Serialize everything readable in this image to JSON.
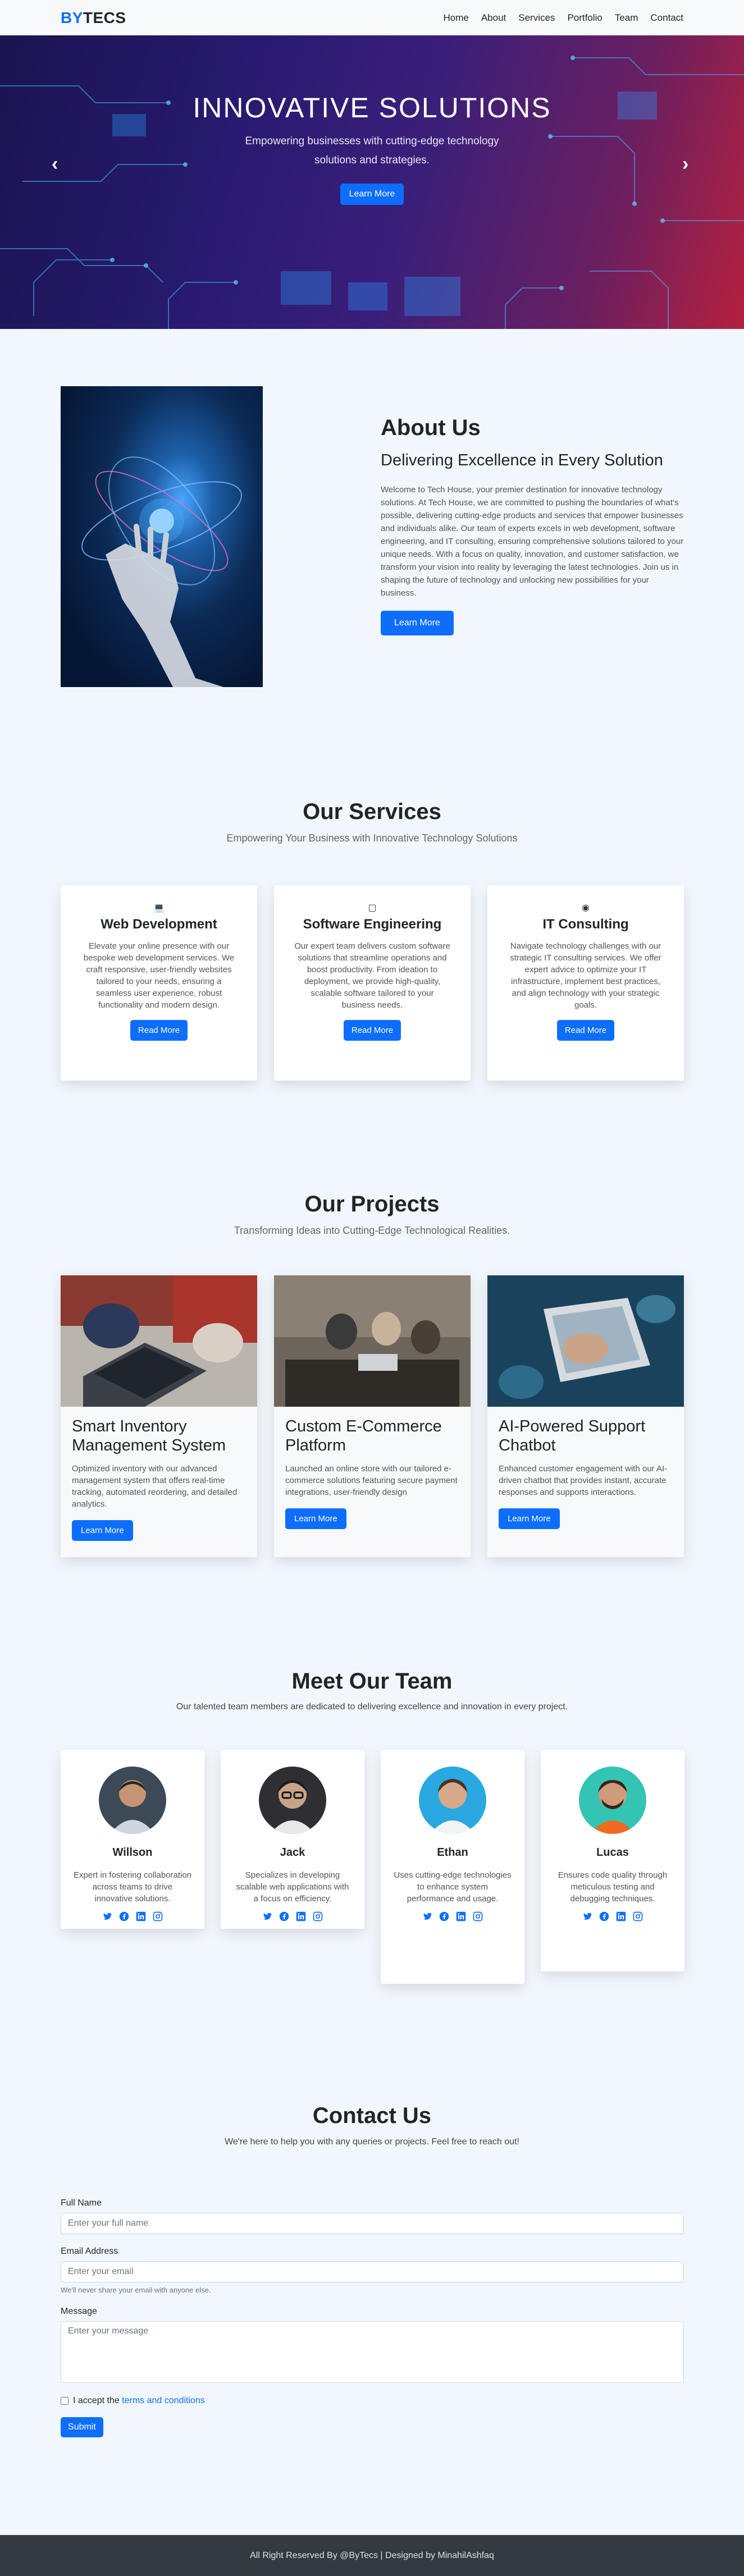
{
  "nav": {
    "brand_part1": "BY",
    "brand_part2": "TECS",
    "links": [
      "Home",
      "About",
      "Services",
      "Portfolio",
      "Team",
      "Contact"
    ]
  },
  "hero": {
    "title": "INNOVATIVE SOLUTIONS",
    "subtitle": "Empowering businesses with cutting-edge technology solutions and strategies.",
    "button": "Learn More",
    "prev_icon": "chevron-left-icon",
    "next_icon": "chevron-right-icon"
  },
  "about": {
    "title": "About Us",
    "subtitle": "Delivering Excellence in Every Solution",
    "body": "Welcome to Tech House, your premier destination for innovative technology solutions. At Tech House, we are committed to pushing the boundaries of what's possible, delivering cutting-edge products and services that empower businesses and individuals alike. Our team of experts excels in web development, software engineering, and IT consulting, ensuring comprehensive solutions tailored to your unique needs. With a focus on quality, innovation, and customer satisfaction, we transform your vision into reality by leveraging the latest technologies. Join us in shaping the future of technology and unlocking new possibilities for your business.",
    "button": "Learn More"
  },
  "services": {
    "title": "Our Services",
    "subtitle": "Empowering Your Business with Innovative Technology Solutions",
    "items": [
      {
        "icon": "laptop-icon",
        "glyph": "💻",
        "title": "Web Development",
        "text": "Elevate your online presence with our bespoke web development services. We craft responsive, user-friendly websites tailored to your needs, ensuring a seamless user experience, robust functionality and modern design.",
        "button": "Read More"
      },
      {
        "icon": "code-window-icon",
        "glyph": "▢",
        "title": "Software Engineering",
        "text": "Our expert team delivers custom software solutions that streamline operations and boost productivity. From ideation to deployment, we provide high-quality, scalable software tailored to your business needs.",
        "button": "Read More"
      },
      {
        "icon": "radio-target-icon",
        "glyph": "◉",
        "title": "IT Consulting",
        "text": "Navigate technology challenges with our strategic IT consulting services. We offer expert advice to optimize your IT infrastructure, implement best practices, and align technology with your strategic goals.",
        "button": "Read More"
      }
    ]
  },
  "projects": {
    "title": "Our Projects",
    "subtitle": "Transforming Ideas into Cutting-Edge Technological Realities.",
    "items": [
      {
        "title": "Smart Inventory Management System",
        "text": "Optimized inventory with our advanced management system that offers real-time tracking, automated reordering, and detailed analytics.",
        "button": "Learn More"
      },
      {
        "title": "Custom E-Commerce Platform",
        "text": "Launched an online store with our tailored e-commerce solutions featuring secure payment integrations, user-friendly design",
        "button": "Learn More"
      },
      {
        "title": "AI-Powered Support Chatbot",
        "text": "Enhanced customer engagement with our AI-driven chatbot that provides instant, accurate responses and supports interactions.",
        "button": "Learn More"
      }
    ]
  },
  "team": {
    "title": "Meet Our Team",
    "subtitle": "Our talented team members are dedicated to delivering excellence and innovation in every project.",
    "social_icons": [
      "twitter-icon",
      "facebook-icon",
      "linkedin-icon",
      "instagram-icon"
    ],
    "members": [
      {
        "name": "Willson",
        "text": "Expert in fostering collaboration across teams to drive innovative solutions."
      },
      {
        "name": "Jack",
        "text": "Specializes in developing scalable web applications with a focus on efficiency."
      },
      {
        "name": "Ethan",
        "text": "Uses cutting-edge technologies to enhance system performance and usage."
      },
      {
        "name": "Lucas",
        "text": "Ensures code quality through meticulous testing and debugging techniques."
      }
    ]
  },
  "contact": {
    "title": "Contact Us",
    "subtitle": "We're here to help you with any queries or projects. Feel free to reach out!",
    "name_label": "Full Name",
    "name_placeholder": "Enter your full name",
    "email_label": "Email Address",
    "email_placeholder": "Enter your email",
    "email_hint": "We'll never share your email with anyone else.",
    "message_label": "Message",
    "message_placeholder": "Enter your message",
    "terms_prefix": "I accept the ",
    "terms_link": "terms and conditions",
    "submit": "Submit"
  },
  "footer": {
    "text": "All Right Reserved By @ByTecs | Designed by MinahilAshfaq"
  },
  "colors": {
    "accent": "#0d6efd",
    "page_bg": "#f1f7fc",
    "footer_bg": "#343a40"
  }
}
